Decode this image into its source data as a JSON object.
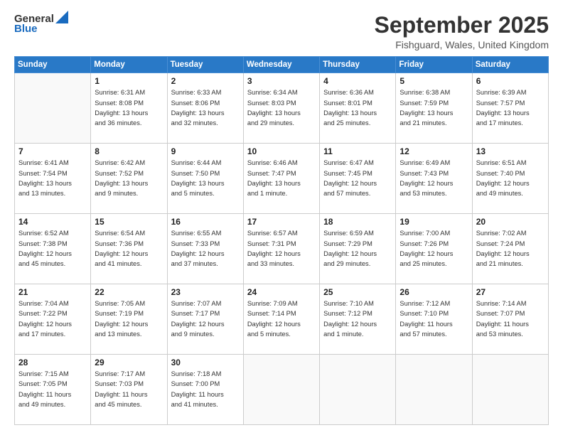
{
  "header": {
    "logo": {
      "line1": "General",
      "line2": "Blue"
    },
    "title": "September 2025",
    "location": "Fishguard, Wales, United Kingdom"
  },
  "weekdays": [
    "Sunday",
    "Monday",
    "Tuesday",
    "Wednesday",
    "Thursday",
    "Friday",
    "Saturday"
  ],
  "weeks": [
    [
      {
        "day": "",
        "info": ""
      },
      {
        "day": "1",
        "info": "Sunrise: 6:31 AM\nSunset: 8:08 PM\nDaylight: 13 hours\nand 36 minutes."
      },
      {
        "day": "2",
        "info": "Sunrise: 6:33 AM\nSunset: 8:06 PM\nDaylight: 13 hours\nand 32 minutes."
      },
      {
        "day": "3",
        "info": "Sunrise: 6:34 AM\nSunset: 8:03 PM\nDaylight: 13 hours\nand 29 minutes."
      },
      {
        "day": "4",
        "info": "Sunrise: 6:36 AM\nSunset: 8:01 PM\nDaylight: 13 hours\nand 25 minutes."
      },
      {
        "day": "5",
        "info": "Sunrise: 6:38 AM\nSunset: 7:59 PM\nDaylight: 13 hours\nand 21 minutes."
      },
      {
        "day": "6",
        "info": "Sunrise: 6:39 AM\nSunset: 7:57 PM\nDaylight: 13 hours\nand 17 minutes."
      }
    ],
    [
      {
        "day": "7",
        "info": "Sunrise: 6:41 AM\nSunset: 7:54 PM\nDaylight: 13 hours\nand 13 minutes."
      },
      {
        "day": "8",
        "info": "Sunrise: 6:42 AM\nSunset: 7:52 PM\nDaylight: 13 hours\nand 9 minutes."
      },
      {
        "day": "9",
        "info": "Sunrise: 6:44 AM\nSunset: 7:50 PM\nDaylight: 13 hours\nand 5 minutes."
      },
      {
        "day": "10",
        "info": "Sunrise: 6:46 AM\nSunset: 7:47 PM\nDaylight: 13 hours\nand 1 minute."
      },
      {
        "day": "11",
        "info": "Sunrise: 6:47 AM\nSunset: 7:45 PM\nDaylight: 12 hours\nand 57 minutes."
      },
      {
        "day": "12",
        "info": "Sunrise: 6:49 AM\nSunset: 7:43 PM\nDaylight: 12 hours\nand 53 minutes."
      },
      {
        "day": "13",
        "info": "Sunrise: 6:51 AM\nSunset: 7:40 PM\nDaylight: 12 hours\nand 49 minutes."
      }
    ],
    [
      {
        "day": "14",
        "info": "Sunrise: 6:52 AM\nSunset: 7:38 PM\nDaylight: 12 hours\nand 45 minutes."
      },
      {
        "day": "15",
        "info": "Sunrise: 6:54 AM\nSunset: 7:36 PM\nDaylight: 12 hours\nand 41 minutes."
      },
      {
        "day": "16",
        "info": "Sunrise: 6:55 AM\nSunset: 7:33 PM\nDaylight: 12 hours\nand 37 minutes."
      },
      {
        "day": "17",
        "info": "Sunrise: 6:57 AM\nSunset: 7:31 PM\nDaylight: 12 hours\nand 33 minutes."
      },
      {
        "day": "18",
        "info": "Sunrise: 6:59 AM\nSunset: 7:29 PM\nDaylight: 12 hours\nand 29 minutes."
      },
      {
        "day": "19",
        "info": "Sunrise: 7:00 AM\nSunset: 7:26 PM\nDaylight: 12 hours\nand 25 minutes."
      },
      {
        "day": "20",
        "info": "Sunrise: 7:02 AM\nSunset: 7:24 PM\nDaylight: 12 hours\nand 21 minutes."
      }
    ],
    [
      {
        "day": "21",
        "info": "Sunrise: 7:04 AM\nSunset: 7:22 PM\nDaylight: 12 hours\nand 17 minutes."
      },
      {
        "day": "22",
        "info": "Sunrise: 7:05 AM\nSunset: 7:19 PM\nDaylight: 12 hours\nand 13 minutes."
      },
      {
        "day": "23",
        "info": "Sunrise: 7:07 AM\nSunset: 7:17 PM\nDaylight: 12 hours\nand 9 minutes."
      },
      {
        "day": "24",
        "info": "Sunrise: 7:09 AM\nSunset: 7:14 PM\nDaylight: 12 hours\nand 5 minutes."
      },
      {
        "day": "25",
        "info": "Sunrise: 7:10 AM\nSunset: 7:12 PM\nDaylight: 12 hours\nand 1 minute."
      },
      {
        "day": "26",
        "info": "Sunrise: 7:12 AM\nSunset: 7:10 PM\nDaylight: 11 hours\nand 57 minutes."
      },
      {
        "day": "27",
        "info": "Sunrise: 7:14 AM\nSunset: 7:07 PM\nDaylight: 11 hours\nand 53 minutes."
      }
    ],
    [
      {
        "day": "28",
        "info": "Sunrise: 7:15 AM\nSunset: 7:05 PM\nDaylight: 11 hours\nand 49 minutes."
      },
      {
        "day": "29",
        "info": "Sunrise: 7:17 AM\nSunset: 7:03 PM\nDaylight: 11 hours\nand 45 minutes."
      },
      {
        "day": "30",
        "info": "Sunrise: 7:18 AM\nSunset: 7:00 PM\nDaylight: 11 hours\nand 41 minutes."
      },
      {
        "day": "",
        "info": ""
      },
      {
        "day": "",
        "info": ""
      },
      {
        "day": "",
        "info": ""
      },
      {
        "day": "",
        "info": ""
      }
    ]
  ]
}
